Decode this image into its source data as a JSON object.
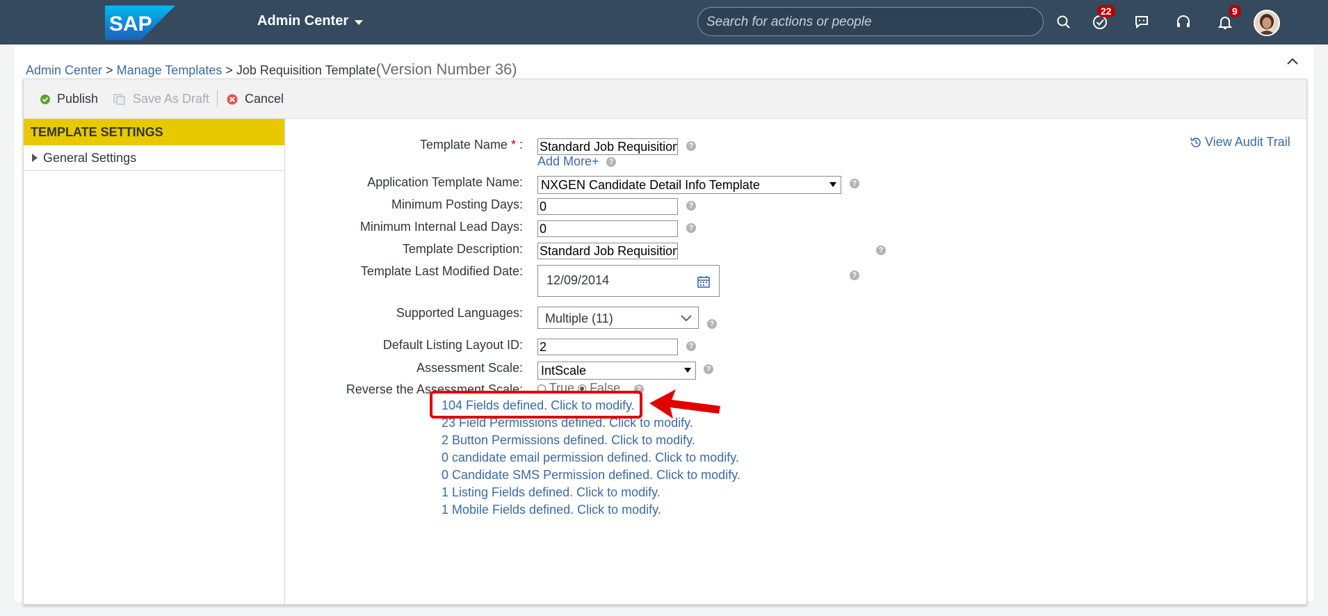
{
  "shellbar": {
    "logo_text": "SAP",
    "app_title": "Admin Center",
    "search_placeholder": "Search for actions or people",
    "todo_badge": "22",
    "notification_badge": "9"
  },
  "breadcrumb": {
    "item1": "Admin Center",
    "sep1": " > ",
    "item2": "Manage Templates",
    "sep2": " > ",
    "current": "Job Requisition Template",
    "version": "(Version Number 36)"
  },
  "toolbar": {
    "publish": "Publish",
    "save_draft": "Save As Draft",
    "cancel": "Cancel"
  },
  "sidebar": {
    "header": "TEMPLATE SETTINGS",
    "items": [
      {
        "label": "General Settings"
      }
    ]
  },
  "view_audit_trail": "View Audit Trail",
  "form": {
    "template_name_label": "Template Name",
    "required_mark": "*",
    "colon": " :",
    "template_name_value": "Standard Job Requisition",
    "add_more": "Add More+",
    "app_template_label": "Application Template Name:",
    "app_template_value": "NXGEN Candidate Detail Info Template",
    "min_posting_label": "Minimum Posting Days:",
    "min_posting_value": "0",
    "min_lead_label": "Minimum Internal Lead Days:",
    "min_lead_value": "0",
    "description_label": "Template Description:",
    "description_value": "Standard Job Requisition",
    "last_modified_label": "Template Last Modified Date:",
    "last_modified_value": "12/09/2014",
    "languages_label": "Supported Languages:",
    "languages_value": "Multiple (11)",
    "layout_id_label": "Default Listing Layout ID:",
    "layout_id_value": "2",
    "assessment_label": "Assessment Scale:",
    "assessment_value": "IntScale",
    "reverse_label": "Reverse the Assessment Scale:",
    "true_label": "True",
    "false_label": "False",
    "reverse_selected": "False"
  },
  "links": [
    "104 Fields defined. Click to modify.",
    "23 Field Permissions defined. Click to modify.",
    "2 Button Permissions defined. Click to modify.",
    "0 candidate email permission defined. Click to modify.",
    "0 Candidate SMS Permission defined. Click to modify.",
    "1 Listing Fields defined. Click to modify.",
    "1 Mobile Fields defined. Click to modify."
  ],
  "help_glyph": "?",
  "colors": {
    "shellbar": "#354a5f",
    "sidebar_header": "#e8c900",
    "link": "#3a6aa7",
    "annotation": "#e10000"
  }
}
